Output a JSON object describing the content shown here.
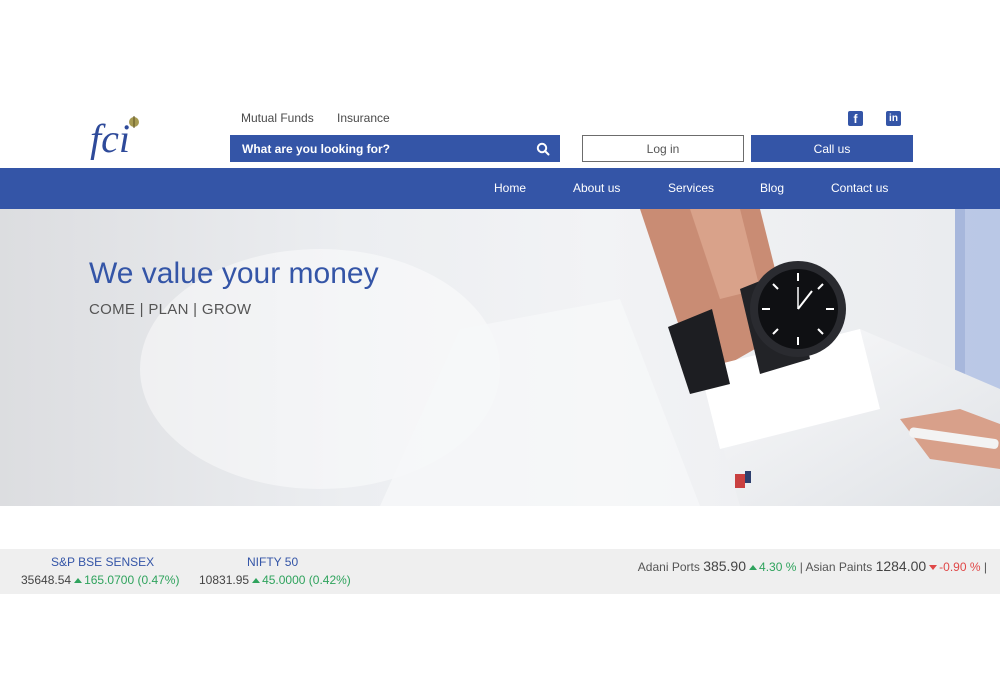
{
  "brand": {
    "logo_text": "fci"
  },
  "top_links": [
    "Mutual Funds",
    "Insurance"
  ],
  "search": {
    "placeholder": "What are you looking for?"
  },
  "buttons": {
    "login": "Log in",
    "call": "Call us"
  },
  "social": {
    "facebook": "f",
    "linkedin": "in"
  },
  "nav": [
    "Home",
    "About us",
    "Services",
    "Blog",
    "Contact us"
  ],
  "hero": {
    "title": "We value your money",
    "subtitle": "COME | PLAN | GROW"
  },
  "indices": [
    {
      "name": "S&P BSE SENSEX",
      "value": "35648.54",
      "change": "165.0700 (0.47%)"
    },
    {
      "name": "NIFTY 50",
      "value": "10831.95",
      "change": "45.0000 (0.42%)"
    }
  ],
  "stocks": [
    {
      "name": "Adani Ports",
      "price": "385.90",
      "change": "4.30 %",
      "direction": "up"
    },
    {
      "name": "Asian Paints",
      "price": "1284.00",
      "change": "-0.90 %",
      "direction": "down"
    }
  ],
  "separator": "|",
  "colors": {
    "brand_blue": "#3455a7",
    "up": "#2fa35d",
    "down": "#e04848"
  }
}
